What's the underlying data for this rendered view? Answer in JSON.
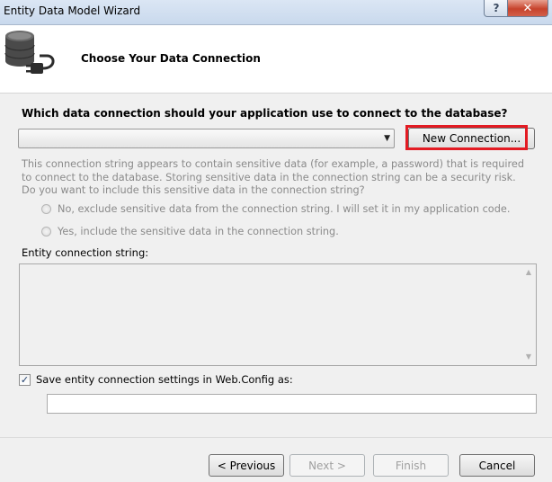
{
  "window": {
    "title": "Entity Data Model Wizard",
    "help_label": "?",
    "close_label": "✕"
  },
  "header": {
    "title": "Choose Your Data Connection",
    "icon": "database-plug-icon"
  },
  "connection": {
    "question": "Which data connection should your application use to connect to the database?",
    "selected_value": "",
    "new_connection_label": "New Connection...",
    "highlight_color": "#e31b23"
  },
  "sensitive": {
    "note": "This connection string appears to contain sensitive data (for example, a password) that is required to connect to the database. Storing sensitive data in the connection string can be a security risk. Do you want to include this sensitive data in the connection string?",
    "option_no": "No, exclude sensitive data from the connection string. I will set it in my application code.",
    "option_yes": "Yes, include the sensitive data in the connection string."
  },
  "entity": {
    "label": "Entity connection string:",
    "value": ""
  },
  "save": {
    "checkbox_label": "Save entity connection settings in Web.Config as:",
    "checked": true,
    "name_value": ""
  },
  "footer": {
    "previous_label": "< Previous",
    "next_label": "Next >",
    "finish_label": "Finish",
    "cancel_label": "Cancel"
  }
}
